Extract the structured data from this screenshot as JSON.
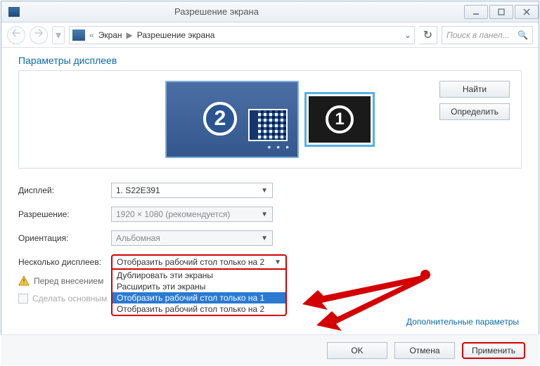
{
  "window": {
    "title": "Разрешение экрана"
  },
  "breadcrumb": {
    "root": "Экран",
    "current": "Разрешение экрана"
  },
  "search": {
    "placeholder": "Поиск в панел..."
  },
  "heading": "Параметры дисплеев",
  "monitors": {
    "primary_num": "2",
    "secondary_num": "1"
  },
  "side_buttons": {
    "find": "Найти",
    "identify": "Определить"
  },
  "form": {
    "display_label": "Дисплей:",
    "display_value": "1. S22E391",
    "resolution_label": "Разрешение:",
    "resolution_value": "1920 × 1080 (рекомендуется)",
    "orientation_label": "Ориентация:",
    "orientation_value": "Альбомная",
    "multi_label": "Несколько дисплеев:",
    "multi_value": "Отобразить рабочий стол только на 2",
    "multi_options": [
      "Дублировать эти экраны",
      "Расширить эти экраны",
      "Отобразить рабочий стол только на 1",
      "Отобразить рабочий стол только на 2"
    ]
  },
  "warning": "Перед внесением",
  "checkbox_label": "Сделать основным",
  "link_advanced": "Дополнительные параметры",
  "footer": {
    "ok": "OK",
    "cancel": "Отмена",
    "apply": "Применить"
  }
}
